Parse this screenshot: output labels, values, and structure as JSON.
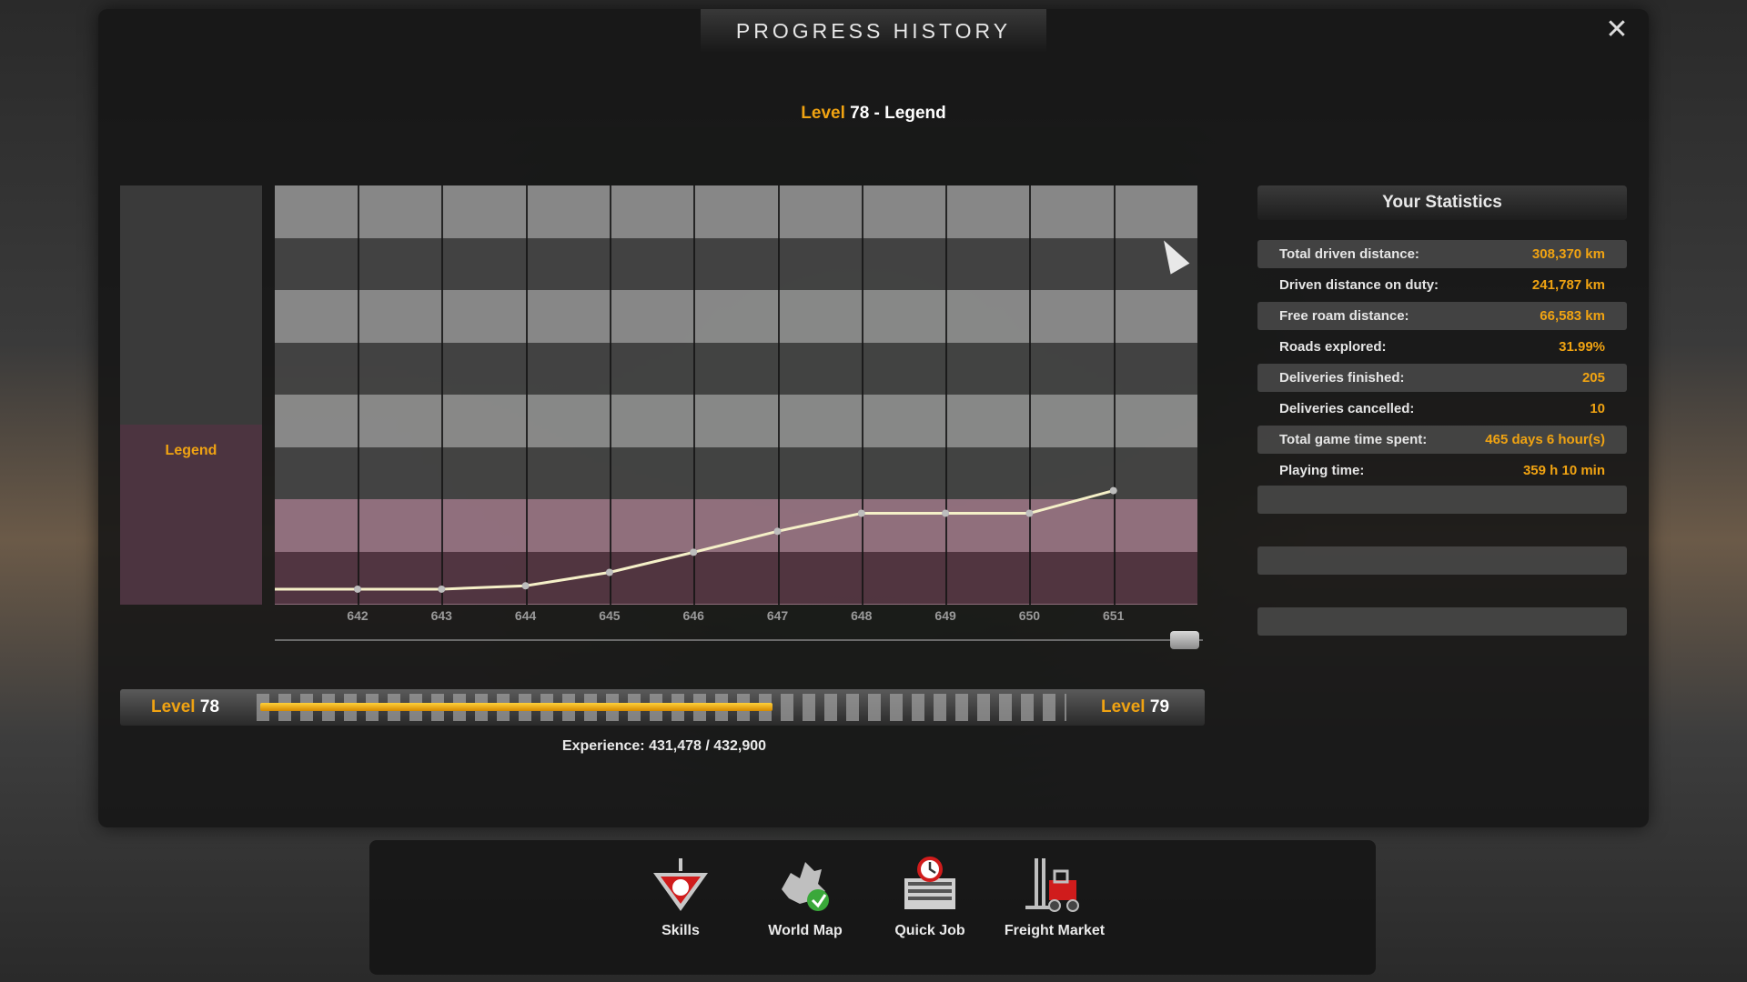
{
  "window": {
    "title": "PROGRESS HISTORY",
    "close_icon": "close-icon"
  },
  "level_heading": {
    "prefix": "Level",
    "rest": "78 - Legend"
  },
  "graph": {
    "legend_label": "Legend",
    "band_colors": [
      "#9b9b9b",
      "#4a4a4a",
      "#9b9b9b",
      "#4a4a4a",
      "#9b9b9b",
      "#4a4a4a",
      "#a47e8e",
      "#5a3a48",
      "#a47e8e"
    ],
    "line_color": "#f5f0c8"
  },
  "chart_data": {
    "type": "line",
    "x": [
      "642",
      "643",
      "644",
      "645",
      "646",
      "647",
      "648",
      "649",
      "650",
      "651"
    ],
    "series": [
      {
        "values": [
          0.37,
          0.37,
          0.45,
          0.77,
          1.25,
          1.75,
          2.18,
          2.18,
          2.18,
          2.72
        ]
      }
    ],
    "ylim": [
      0,
      10
    ],
    "grid": true
  },
  "stats": {
    "title": "Your Statistics",
    "rows": [
      {
        "label": "Total driven distance:",
        "value": "308,370 km"
      },
      {
        "label": "Driven distance on duty:",
        "value": "241,787 km"
      },
      {
        "label": "Free roam distance:",
        "value": "66,583 km"
      },
      {
        "label": "Roads explored:",
        "value": "31.99%"
      },
      {
        "label": "Deliveries finished:",
        "value": "205"
      },
      {
        "label": "Deliveries cancelled:",
        "value": "10"
      },
      {
        "label": "Total game time spent:",
        "value": "465 days 6 hour(s)"
      },
      {
        "label": "Playing time:",
        "value": "359 h 10 min"
      }
    ]
  },
  "levelbar": {
    "left_prefix": "Level",
    "left_num": "78",
    "right_prefix": "Level",
    "right_num": "79",
    "experience": "Experience: 431,478 / 432,900",
    "progress": 0.64
  },
  "menu": {
    "items": [
      {
        "label": "Skills",
        "icon": "skills-icon"
      },
      {
        "label": "World Map",
        "icon": "world-map-icon"
      },
      {
        "label": "Quick Job",
        "icon": "quick-job-icon"
      },
      {
        "label": "Freight Market",
        "icon": "freight-market-icon"
      }
    ]
  }
}
